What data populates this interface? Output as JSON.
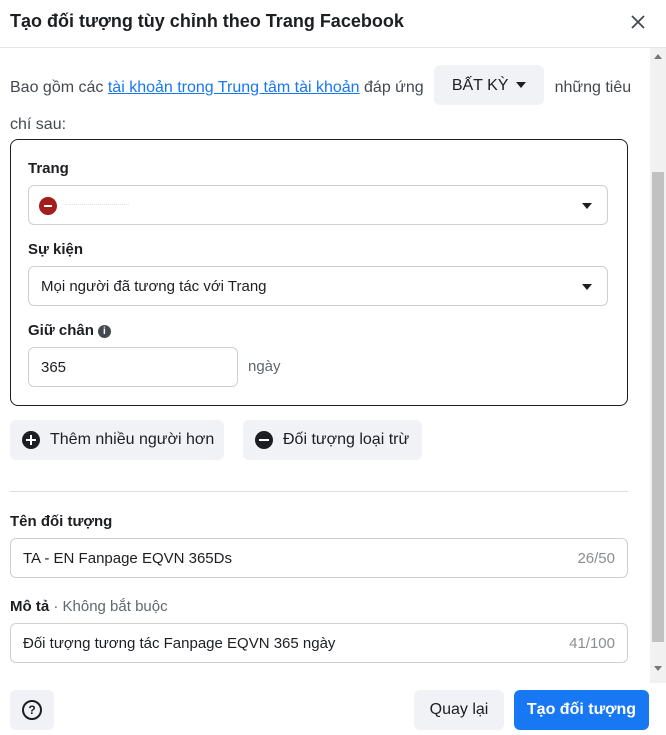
{
  "dialog": {
    "title": "Tạo đối tượng tùy chỉnh theo Trang Facebook",
    "close_icon": "close-icon"
  },
  "intro": {
    "prefix": "Bao gồm các",
    "link": "tài khoản trong Trung tâm tài khoản",
    "middle": "đáp ứng",
    "match_value": "BẤT KỲ",
    "suffix": "những tiêu chí sau:"
  },
  "criteria": {
    "page_label": "Trang",
    "page_value": "",
    "event_label": "Sự kiện",
    "event_value": "Mọi người đã tương tác với Trang",
    "retention_label": "Giữ chân",
    "retention_value": "365",
    "retention_unit": "ngày"
  },
  "actions": {
    "include_more": "Thêm nhiều người hơn",
    "exclude": "Đối tượng loại trừ"
  },
  "audience_name": {
    "label": "Tên đối tượng",
    "value": "TA - EN Fanpage EQVN 365Ds",
    "count": "26/50"
  },
  "description": {
    "label": "Mô tả",
    "optional": "· Không bắt buộc",
    "value": "Đối tượng tương tác Fanpage EQVN 365 ngày",
    "count": "41/100"
  },
  "footer": {
    "help_icon": "question-icon",
    "back": "Quay lại",
    "create": "Tạo đối tượng"
  },
  "colors": {
    "primary": "#1877f2",
    "link": "#1877f2",
    "secondary_bg": "#f0f2f5"
  }
}
